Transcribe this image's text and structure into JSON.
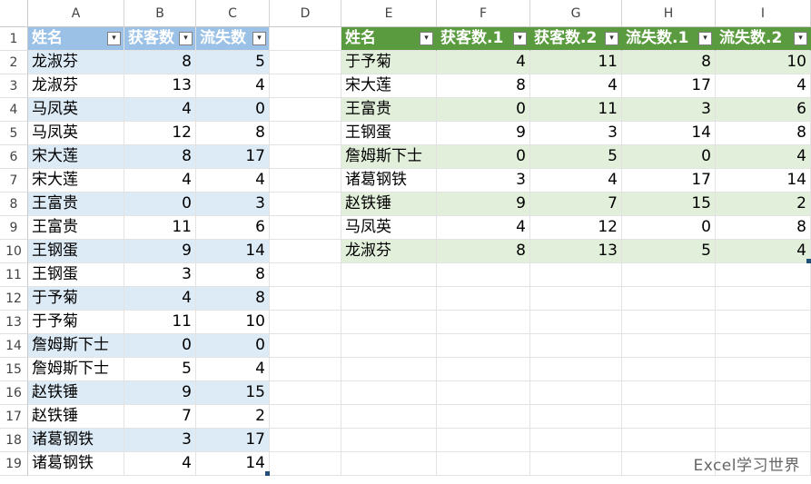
{
  "columns": [
    "A",
    "B",
    "C",
    "D",
    "E",
    "F",
    "G",
    "H",
    "I"
  ],
  "rows": [
    "1",
    "2",
    "3",
    "4",
    "5",
    "6",
    "7",
    "8",
    "9",
    "10",
    "11",
    "12",
    "13",
    "14",
    "15",
    "16",
    "17",
    "18",
    "19"
  ],
  "table1": {
    "headers": [
      "姓名",
      "获客数",
      "流失数"
    ],
    "header_color": "#9bc2e6",
    "band_color": "#ddebf7",
    "rows": [
      [
        "龙淑芬",
        "8",
        "5"
      ],
      [
        "龙淑芬",
        "13",
        "4"
      ],
      [
        "马凤英",
        "4",
        "0"
      ],
      [
        "马凤英",
        "12",
        "8"
      ],
      [
        "宋大莲",
        "8",
        "17"
      ],
      [
        "宋大莲",
        "4",
        "4"
      ],
      [
        "王富贵",
        "0",
        "3"
      ],
      [
        "王富贵",
        "11",
        "6"
      ],
      [
        "王钢蛋",
        "9",
        "14"
      ],
      [
        "王钢蛋",
        "3",
        "8"
      ],
      [
        "于予菊",
        "4",
        "8"
      ],
      [
        "于予菊",
        "11",
        "10"
      ],
      [
        "詹姆斯下士",
        "0",
        "0"
      ],
      [
        "詹姆斯下士",
        "5",
        "4"
      ],
      [
        "赵铁锤",
        "9",
        "15"
      ],
      [
        "赵铁锤",
        "7",
        "2"
      ],
      [
        "诸葛钢铁",
        "3",
        "17"
      ],
      [
        "诸葛钢铁",
        "4",
        "14"
      ]
    ]
  },
  "table2": {
    "headers": [
      "姓名",
      "获客数.1",
      "获客数.2",
      "流失数.1",
      "流失数.2"
    ],
    "header_color": "#5b9b3f",
    "band_color": "#e2efda",
    "rows": [
      [
        "于予菊",
        "4",
        "11",
        "8",
        "10"
      ],
      [
        "宋大莲",
        "8",
        "4",
        "17",
        "4"
      ],
      [
        "王富贵",
        "0",
        "11",
        "3",
        "6"
      ],
      [
        "王钢蛋",
        "9",
        "3",
        "14",
        "8"
      ],
      [
        "詹姆斯下士",
        "0",
        "5",
        "0",
        "4"
      ],
      [
        "诸葛钢铁",
        "3",
        "4",
        "17",
        "14"
      ],
      [
        "赵铁锤",
        "9",
        "7",
        "15",
        "2"
      ],
      [
        "马凤英",
        "4",
        "12",
        "0",
        "8"
      ],
      [
        "龙淑芬",
        "8",
        "13",
        "5",
        "4"
      ]
    ]
  },
  "filter_icon": "dropdown-arrow-icon",
  "watermark": "Excel学习世界"
}
